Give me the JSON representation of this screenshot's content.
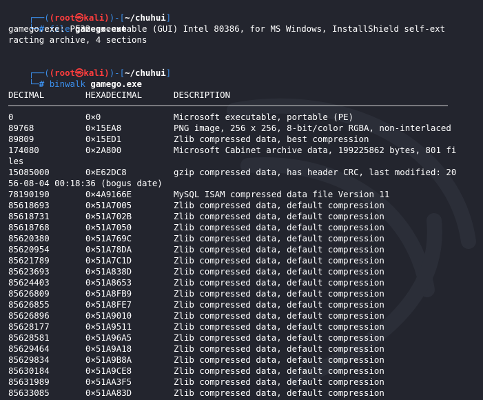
{
  "prompt": {
    "root": "(root㉿kali)",
    "dir": "~/chuhui",
    "hash": "#"
  },
  "cmd1": {
    "name": "file",
    "arg": "gamego.exe"
  },
  "file_output": [
    "gamego.exe: PE32 executable (GUI) Intel 80386, for MS Windows, InstallShield self-ext",
    "racting archive, 4 sections"
  ],
  "cmd2": {
    "name": "binwalk",
    "arg": "gamego.exe"
  },
  "table": {
    "headers": [
      "DECIMAL",
      "HEXADECIMAL",
      "DESCRIPTION"
    ],
    "rows": [
      [
        "0",
        "0×0",
        "Microsoft executable, portable (PE)"
      ],
      [
        "89768",
        "0×15EA8",
        "PNG image, 256 x 256, 8-bit/color RGBA, non-interlaced"
      ],
      [
        "89809",
        "0×15ED1",
        "Zlib compressed data, best compression"
      ],
      [
        "174080",
        "0×2A800",
        "Microsoft Cabinet archive data, 199225862 bytes, 801 fi"
      ],
      [
        "",
        "",
        ""
      ],
      [
        "15085000",
        "0×E62DC8",
        "gzip compressed data, has header CRC, last modified: 20"
      ],
      [
        "",
        "",
        ""
      ],
      [
        "78190190",
        "0×4A9166E",
        "MySQL ISAM compressed data file Version 11"
      ],
      [
        "85618693",
        "0×51A7005",
        "Zlib compressed data, default compression"
      ],
      [
        "85618731",
        "0×51A702B",
        "Zlib compressed data, default compression"
      ],
      [
        "85618768",
        "0×51A7050",
        "Zlib compressed data, default compression"
      ],
      [
        "85620380",
        "0×51A769C",
        "Zlib compressed data, default compression"
      ],
      [
        "85620954",
        "0×51A78DA",
        "Zlib compressed data, default compression"
      ],
      [
        "85621789",
        "0×51A7C1D",
        "Zlib compressed data, default compression"
      ],
      [
        "85623693",
        "0×51A838D",
        "Zlib compressed data, default compression"
      ],
      [
        "85624403",
        "0×51A8653",
        "Zlib compressed data, default compression"
      ],
      [
        "85626809",
        "0×51A8FB9",
        "Zlib compressed data, default compression"
      ],
      [
        "85626855",
        "0×51A8FE7",
        "Zlib compressed data, default compression"
      ],
      [
        "85626896",
        "0×51A9010",
        "Zlib compressed data, default compression"
      ],
      [
        "85628177",
        "0×51A9511",
        "Zlib compressed data, default compression"
      ],
      [
        "85628581",
        "0×51A96A5",
        "Zlib compressed data, default compression"
      ],
      [
        "85629464",
        "0×51A9A18",
        "Zlib compressed data, default compression"
      ],
      [
        "85629834",
        "0×51A9B8A",
        "Zlib compressed data, default compression"
      ],
      [
        "85630184",
        "0×51A9CE8",
        "Zlib compressed data, default compression"
      ],
      [
        "85631989",
        "0×51AA3F5",
        "Zlib compressed data, default compression"
      ],
      [
        "85633085",
        "0×51AA83D",
        "Zlib compressed data, default compression"
      ]
    ],
    "wrap": [
      "les",
      "56-08-04 00:18:36 (bogus date)"
    ]
  }
}
